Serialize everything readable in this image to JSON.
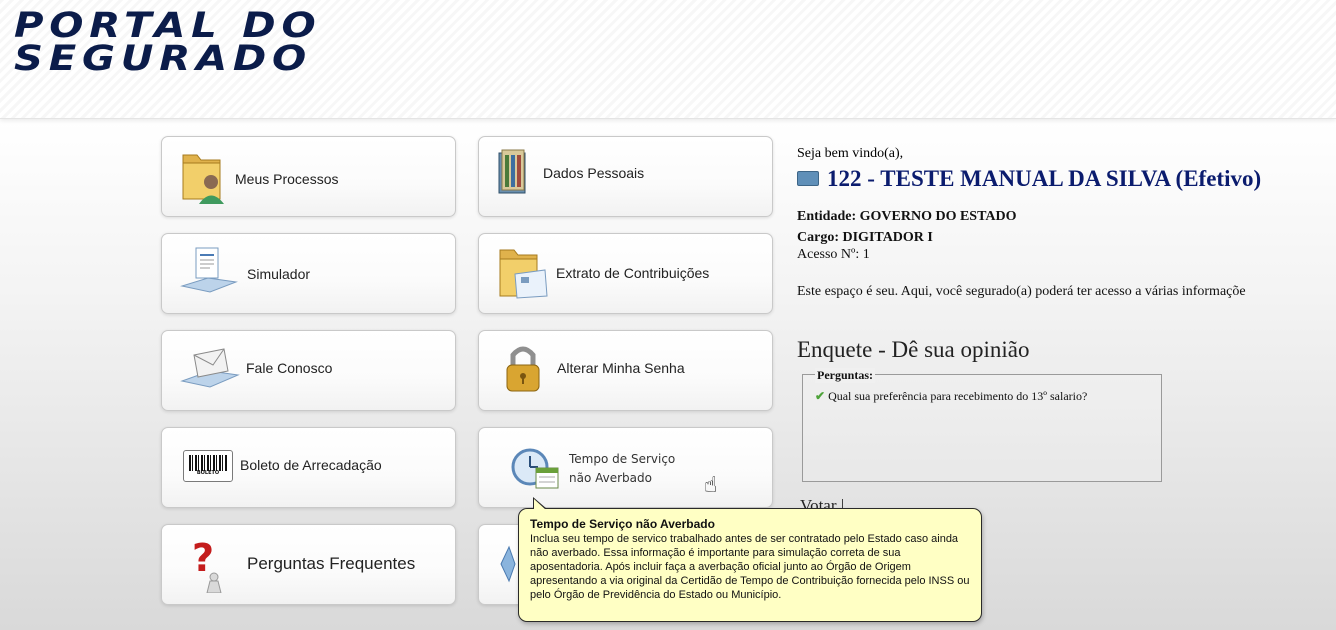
{
  "header": {
    "logo_line1": "PORTAL DO",
    "logo_line2": "SEGURADO"
  },
  "menu": {
    "meus_processos": "Meus Processos",
    "dados_pessoais": "Dados Pessoais",
    "simulador": "Simulador",
    "extrato": "Extrato de Contribuições",
    "fale_conosco": "Fale Conosco",
    "alterar_senha": "Alterar Minha Senha",
    "boleto": "Boleto de Arrecadação",
    "tempo_servico_line1": "Tempo de Serviço",
    "tempo_servico_line2": "não Averbado",
    "perguntas": "Perguntas Frequentes",
    "boleto_icon_text": "BOLETO"
  },
  "welcome": {
    "greeting": "Seja bem vindo(a),",
    "user_id": "122",
    "separator": "-",
    "user_name": "TESTE MANUAL DA SILVA (Efetivo)",
    "entidade_label": "Entidade:",
    "entidade_value": "GOVERNO DO ESTADO",
    "cargo_label": "Cargo:",
    "cargo_value": "DIGITADOR I",
    "acesso": "Acesso Nº: 1",
    "intro": "Este espaço é seu. Aqui, você segurado(a) poderá ter acesso a várias informaçõe"
  },
  "poll": {
    "title": "Enquete - Dê sua opinião",
    "legend": "Perguntas:",
    "question": "Qual sua preferência para recebimento do 13º salario?",
    "vote_label": "Votar |"
  },
  "tooltip": {
    "title": "Tempo de Serviço não Averbado",
    "body": "Inclua seu tempo de servico trabalhado antes de ser contratado pelo Estado caso ainda não averbado. Essa informação é importante para simulação correta de sua aposentadoria. Após incluir faça a averbação oficial junto ao Órgão de Origem apresentando a via original da Certidão de Tempo de Contribuição fornecida pelo INSS ou pelo Órgão de Previdência do Estado ou Município."
  }
}
